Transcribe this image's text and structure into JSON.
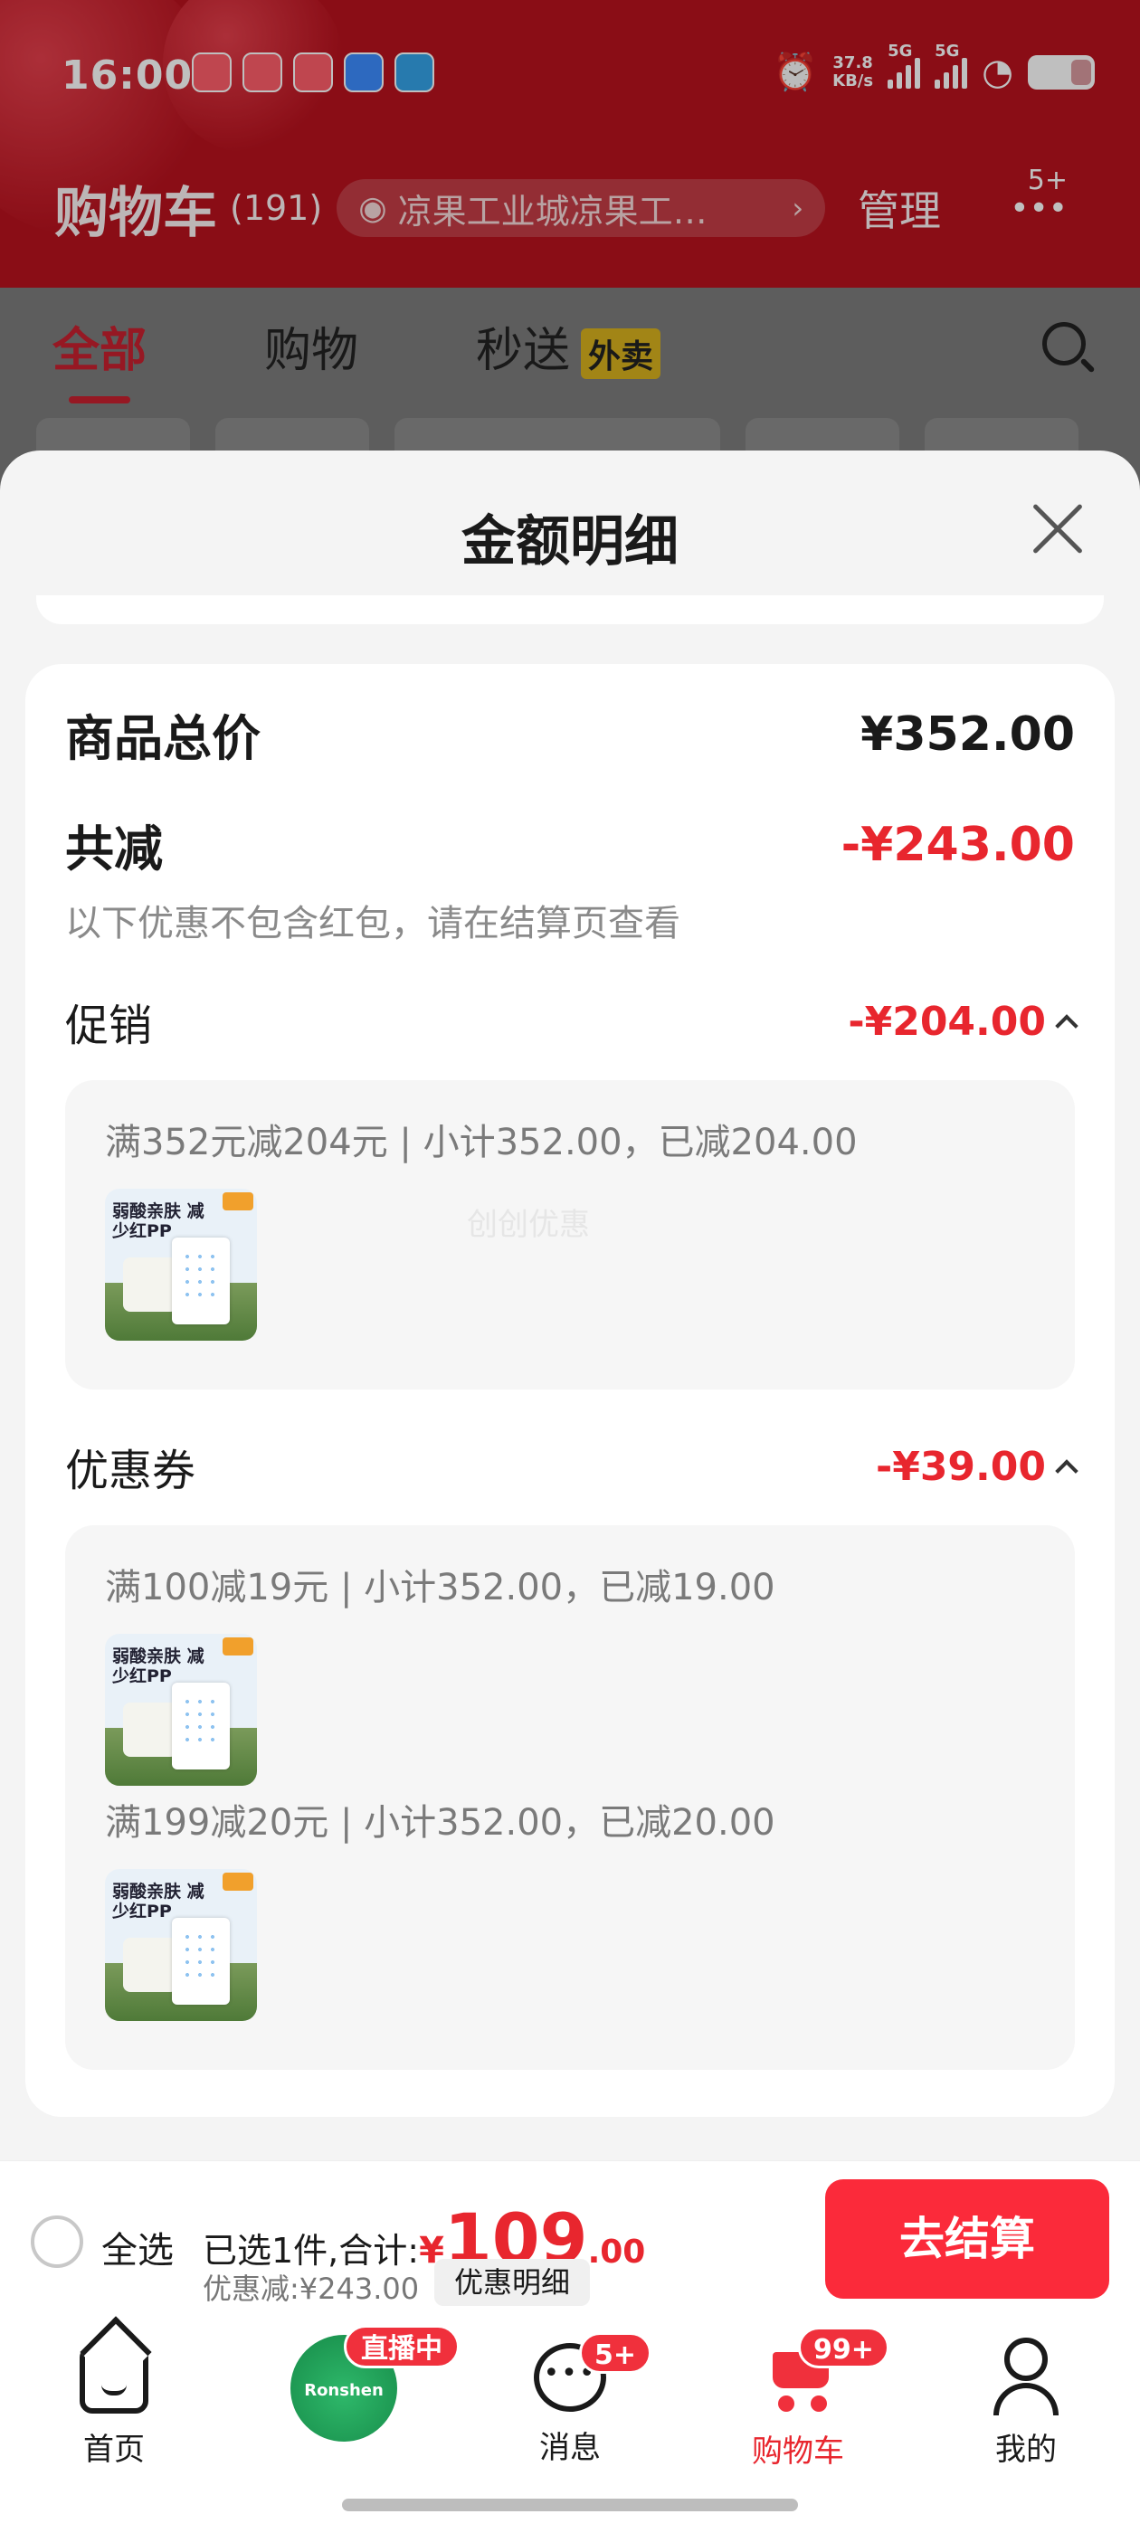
{
  "status_bar": {
    "time": "16:00",
    "net_speed_value": "37.8",
    "net_speed_unit": "KB/s",
    "signal_1": "5G",
    "signal_2": "5G"
  },
  "header": {
    "title": "购物车",
    "count": "(191)",
    "location": "凉果工业城凉果工…",
    "manage": "管理",
    "more_badge": "5+"
  },
  "tabs": {
    "all": "全部",
    "shopping": "购物",
    "flash": "秒送",
    "flash_tag": "外卖"
  },
  "sheet": {
    "title": "金额明细",
    "total_label": "商品总价",
    "total_value": "¥352.00",
    "reduce_label": "共减",
    "reduce_value": "-¥243.00",
    "reduce_note": "以下优惠不包含红包，请在结算页查看",
    "promo_label": "促销",
    "promo_value": "-¥204.00",
    "promo_line": "满352元减204元 | 小计352.00，已减204.00",
    "watermark": "创创优惠",
    "coupon_label": "优惠券",
    "coupon_value": "-¥39.00",
    "coupon_line_1": "满100减19元 | 小计352.00，已减19.00",
    "coupon_line_2": "满199减20元 | 小计352.00，已减20.00",
    "thumb_text": "弱酸亲肤 减少红PP"
  },
  "checkout": {
    "select_all": "全选",
    "selected_prefix": "已选1件,合计:",
    "currency": "¥",
    "amount_int": "109",
    "amount_dec": ".00",
    "discount": "优惠减:¥243.00",
    "detail_button": "优惠明细",
    "checkout_button": "去结算"
  },
  "bottom_nav": {
    "home": "首页",
    "live_badge": "直播中",
    "live_brand": "Ronshen",
    "messages": "消息",
    "messages_badge": "5+",
    "cart": "购物车",
    "cart_badge": "99+",
    "me": "我的"
  },
  "colors": {
    "brand_red": "#b8121e",
    "price_red": "#e8262e",
    "checkout_red": "#fb2a3a"
  }
}
